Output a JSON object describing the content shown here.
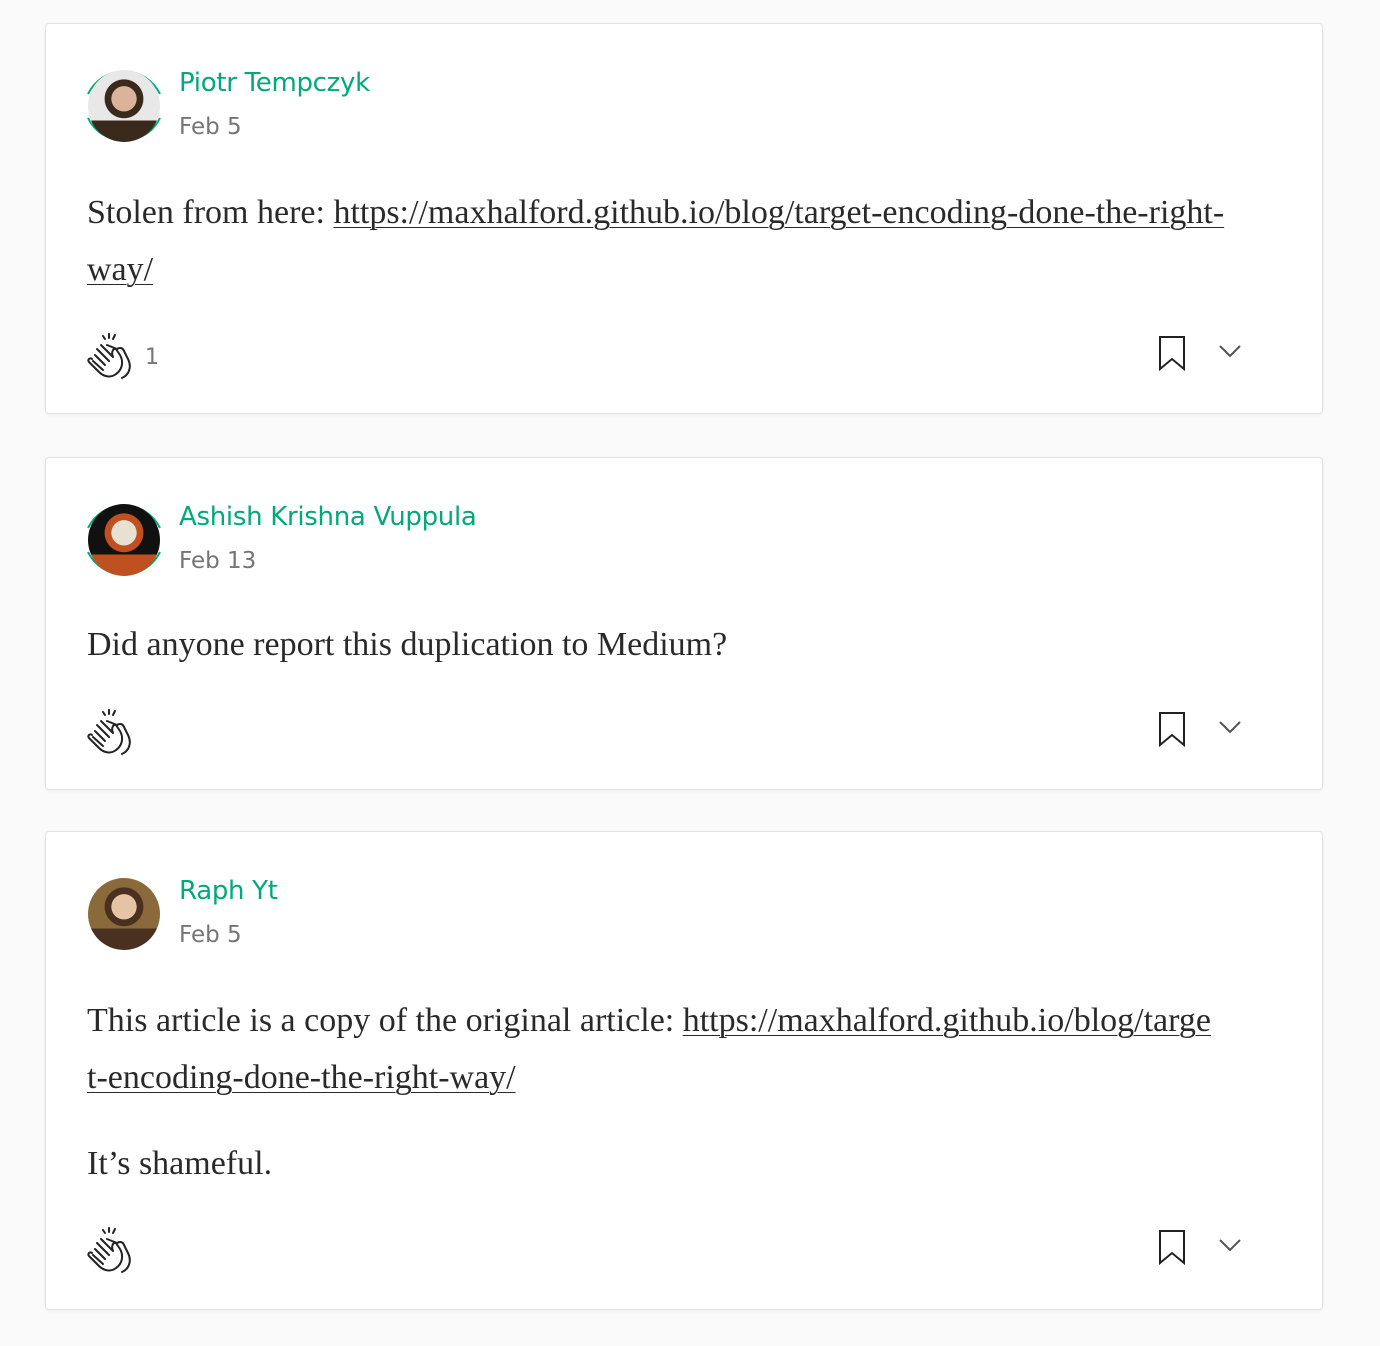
{
  "accent_color": "#03a87c",
  "comments": [
    {
      "author": "Piotr Tempczyk",
      "date": "Feb 5",
      "has_ring": true,
      "avatar_colors": [
        "#e8e8e8",
        "#3a2a1c",
        "#d9b49a"
      ],
      "paragraphs": [
        {
          "text": "Stolen from here: ",
          "link": "https://maxhalford.github.io/blog/target-encoding-done-the-right-way/"
        }
      ],
      "clap_count": "1",
      "icons": {
        "clap": "clap-icon",
        "bookmark": "bookmark-icon",
        "more": "chevron-down-icon"
      }
    },
    {
      "author": "Ashish Krishna Vuppula",
      "date": "Feb 13",
      "has_ring": true,
      "avatar_colors": [
        "#111111",
        "#c0501f",
        "#e8e0d0"
      ],
      "paragraphs": [
        {
          "text": "Did anyone report this duplication to Medium?",
          "link": ""
        }
      ],
      "clap_count": "",
      "icons": {
        "clap": "clap-icon",
        "bookmark": "bookmark-icon",
        "more": "chevron-down-icon"
      }
    },
    {
      "author": "Raph Yt",
      "date": "Feb 5",
      "has_ring": false,
      "avatar_colors": [
        "#8a6a3a",
        "#4a3020",
        "#e6c3a5"
      ],
      "paragraphs": [
        {
          "text": "This article is a copy of the original article: ",
          "link": "https://maxhalford.github.io/blog/target-encoding-done-the-right-way/"
        },
        {
          "text": "It’s shameful.",
          "link": ""
        }
      ],
      "clap_count": "",
      "icons": {
        "clap": "clap-icon",
        "bookmark": "bookmark-icon",
        "more": "chevron-down-icon"
      }
    }
  ]
}
